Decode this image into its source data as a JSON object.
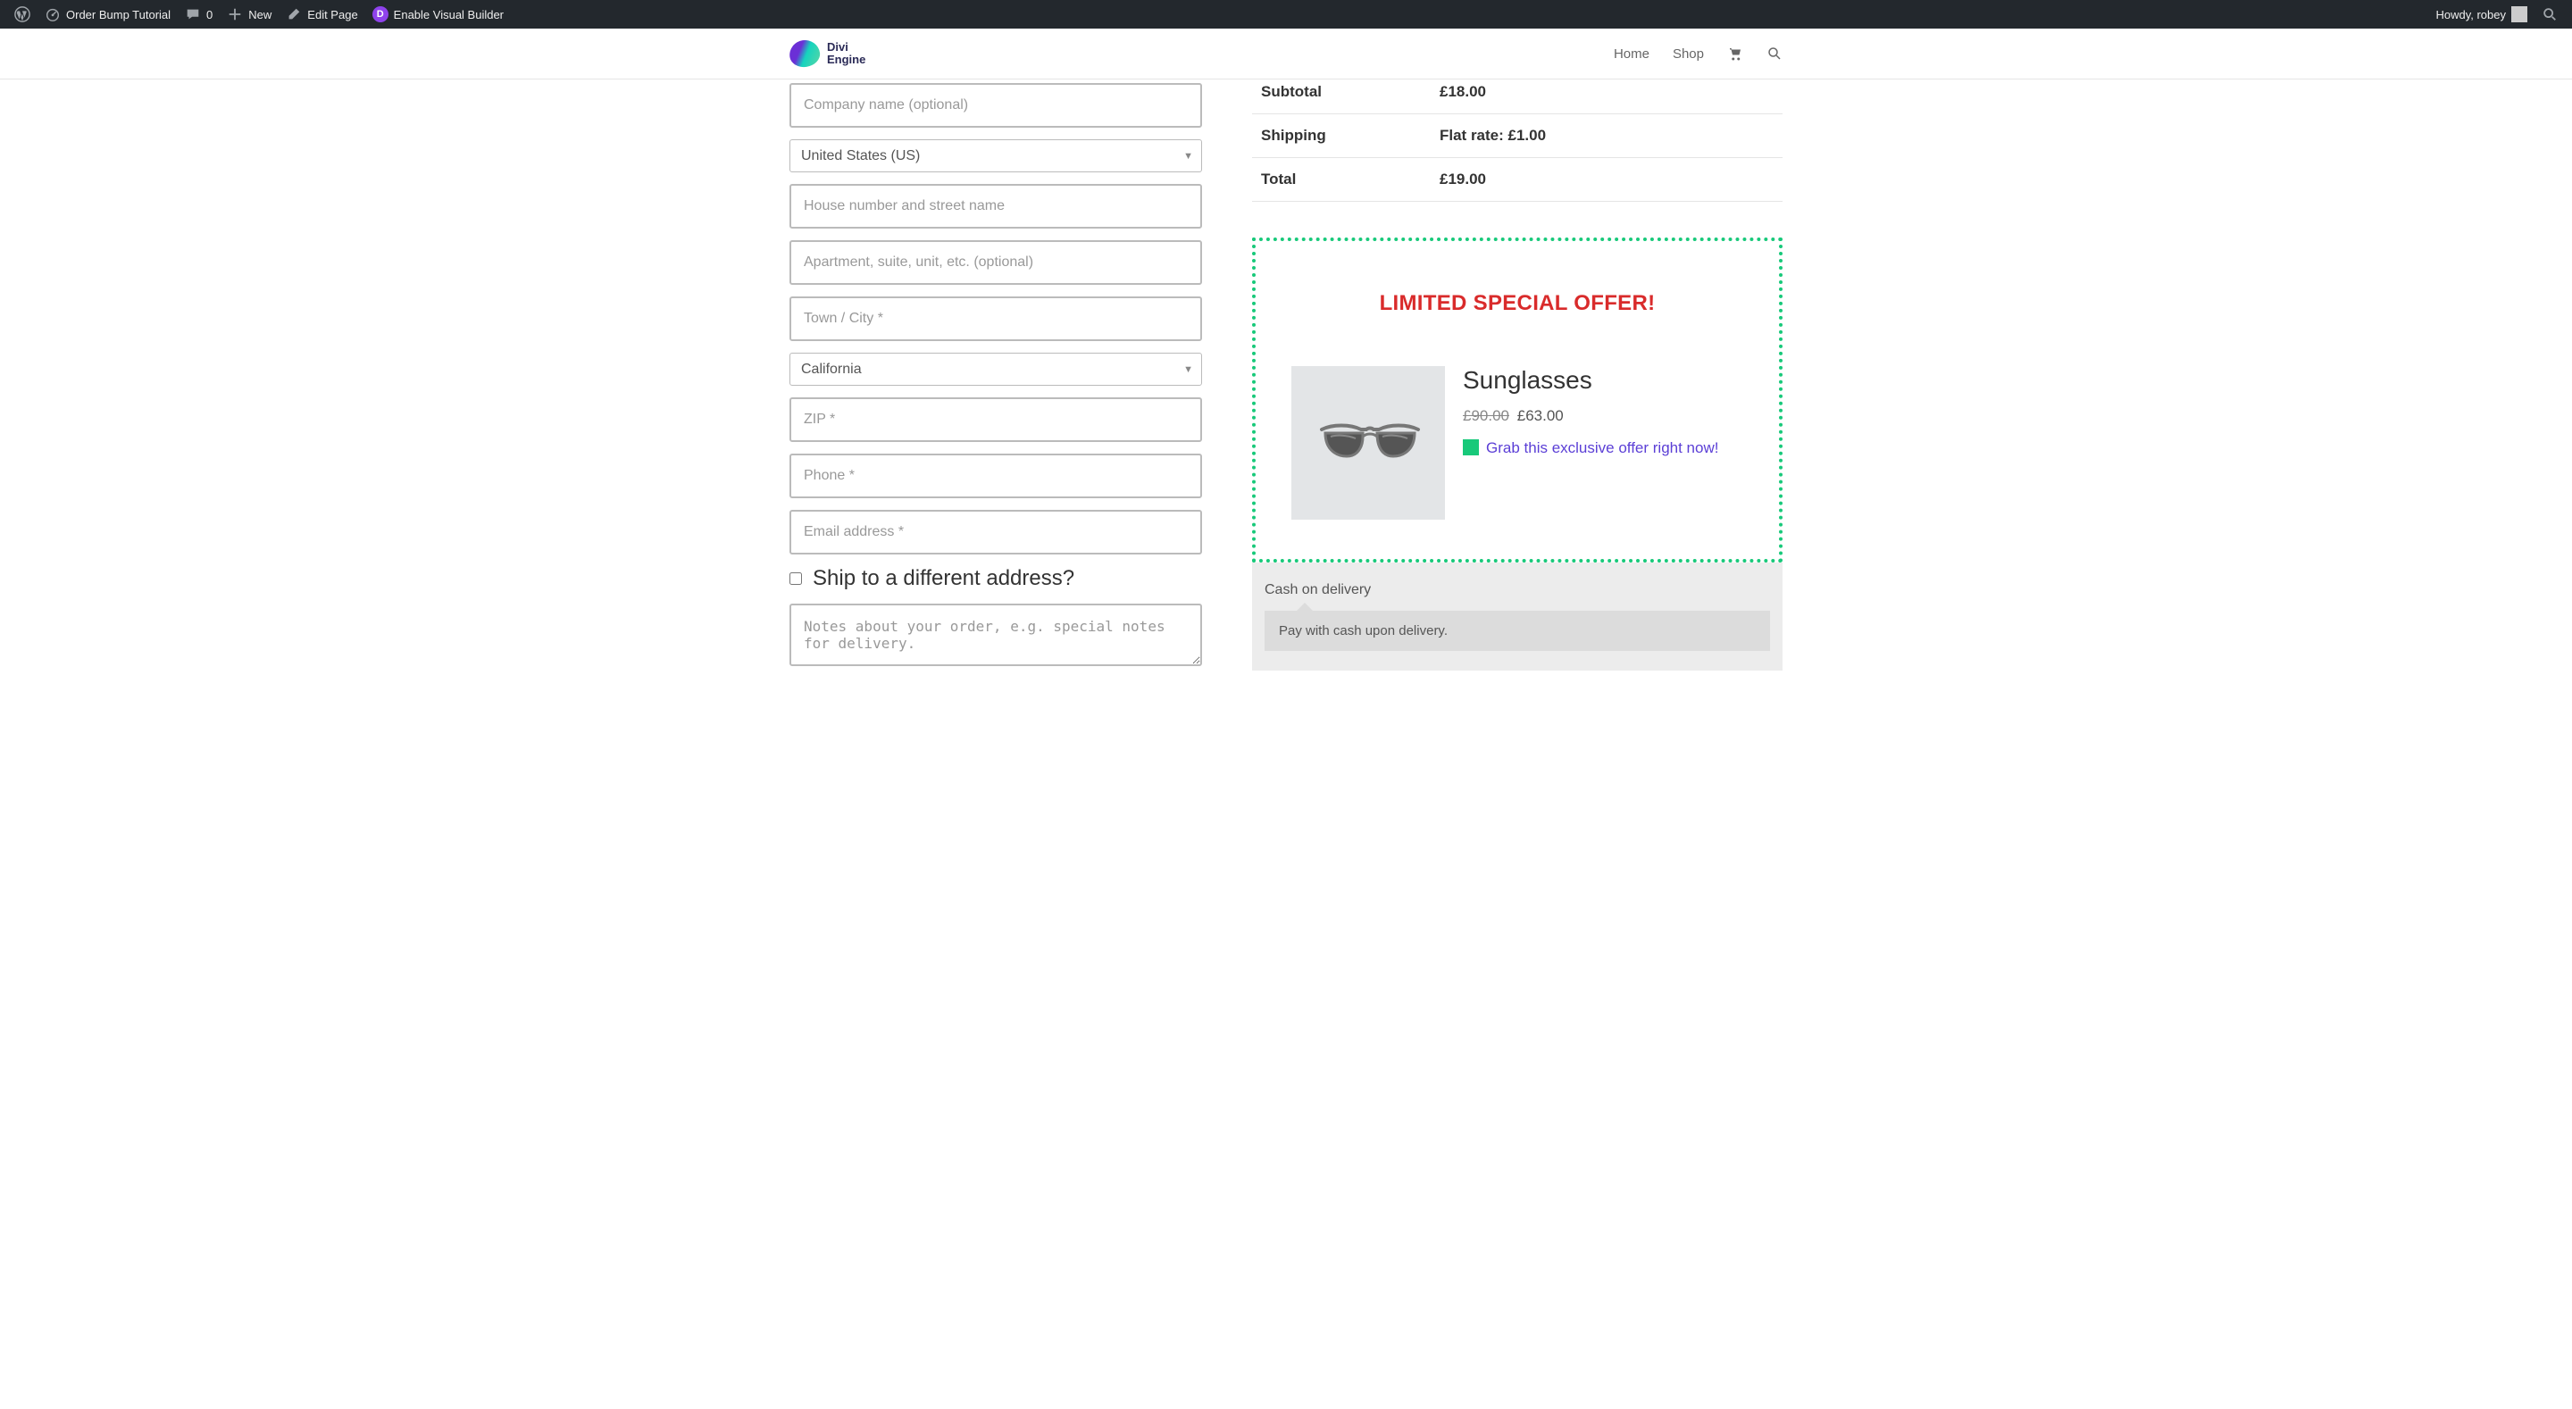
{
  "admin_bar": {
    "site_title": "Order Bump Tutorial",
    "comments_count": "0",
    "new_label": "New",
    "edit_page_label": "Edit Page",
    "visual_builder_label": "Enable Visual Builder",
    "howdy": "Howdy, robey"
  },
  "header": {
    "logo_text_line1": "Divi",
    "logo_text_line2": "Engine",
    "nav": {
      "home": "Home",
      "shop": "Shop"
    }
  },
  "billing": {
    "company_placeholder": "Company name (optional)",
    "country_selected": "United States (US)",
    "street_placeholder": "House number and street name",
    "apt_placeholder": "Apartment, suite, unit, etc. (optional)",
    "city_placeholder": "Town / City *",
    "state_selected": "California",
    "zip_placeholder": "ZIP *",
    "phone_placeholder": "Phone *",
    "email_placeholder": "Email address *",
    "ship_diff_label": "Ship to a different address?",
    "notes_placeholder": "Notes about your order, e.g. special notes for delivery."
  },
  "order": {
    "subtotal_label": "Subtotal",
    "subtotal_value": "£18.00",
    "shipping_label": "Shipping",
    "shipping_value": "Flat rate: £1.00",
    "total_label": "Total",
    "total_value": "£19.00"
  },
  "bump": {
    "headline": "LIMITED SPECIAL OFFER!",
    "product_name": "Sunglasses",
    "price_old": "£90.00",
    "price_new": "£63.00",
    "cta_text": "Grab this exclusive offer right now!"
  },
  "payment": {
    "method_label": "Cash on delivery",
    "method_desc": "Pay with cash upon delivery."
  }
}
